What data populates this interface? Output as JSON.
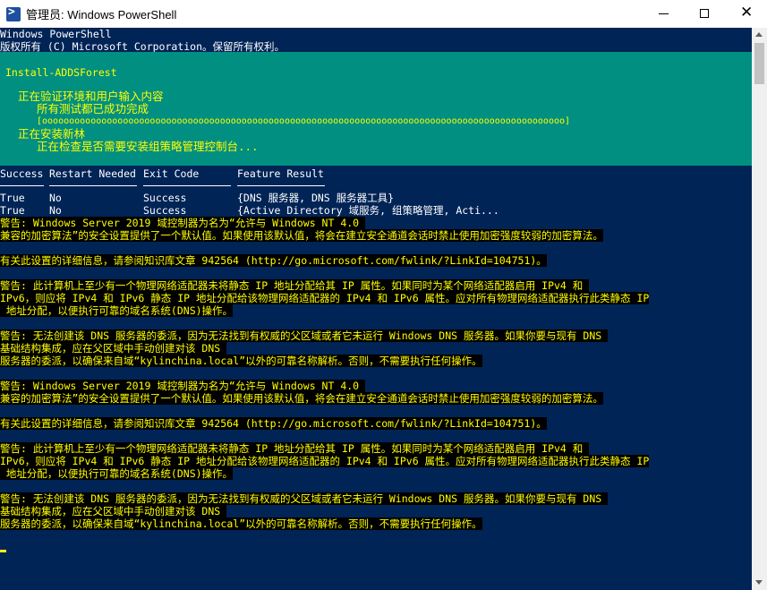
{
  "window": {
    "title": "管理员: Windows PowerShell",
    "icon": "powershell-icon",
    "controls": {
      "minimize": "minimize-icon",
      "maximize": "maximize-icon",
      "close": "close-icon"
    }
  },
  "console": {
    "banner": [
      "Windows PowerShell",
      "版权所有 (C) Microsoft Corporation。保留所有权利。"
    ],
    "progress": {
      "activity": "Install-ADDSForest",
      "status1": "正在验证环境和用户输入内容",
      "status1_detail": "所有测试都已成功完成",
      "bar": "[ooooooooooooooooooooooooooooooooooooooooooooooooooooooooooooooooooooooooooooooooooooooooooooooooo]",
      "status2": "正在安装新林",
      "status2_detail": "正在检查是否需要安装组策略管理控制台..."
    },
    "table": {
      "headers": [
        "Success",
        "Restart Needed",
        "Exit Code",
        "Feature Result"
      ],
      "rows": [
        [
          "True",
          "No",
          "Success",
          "{DNS 服务器, DNS 服务器工具}"
        ],
        [
          "True",
          "No",
          "Success",
          "{Active Directory 域服务, 组策略管理, Acti..."
        ]
      ]
    },
    "warnings": [
      "警告: Windows Server 2019 域控制器为名为“允许与 Windows NT 4.0 ",
      "兼容的加密算法”的安全设置提供了一个默认值。如果使用该默认值，将会在建立安全通道会话时禁止使用加密强度较弱的加密算法。",
      "有关此设置的详细信息，请参阅知识库文章 942564 (http://go.microsoft.com/fwlink/?LinkId=104751)。",
      "警告: 此计算机上至少有一个物理网络适配器未将静态 IP 地址分配给其 IP 属性。如果同时为某个网络适配器启用 IPv4 和 ",
      "IPv6，则应将 IPv4 和 IPv6 静态 IP 地址分配给该物理网络适配器的 IPv4 和 IPv6 属性。应对所有物理网络适配器执行此类静态 IP",
      " 地址分配，以便执行可靠的域名系统(DNS)操作。",
      "警告: 无法创建该 DNS 服务器的委派，因为无法找到有权威的父区域或者它未运行 Windows DNS 服务器。如果你要与现有 DNS ",
      "基础结构集成，应在父区域中手动创建对该 DNS ",
      "服务器的委派，以确保来自域“kylinchina.local”以外的可靠名称解析。否则，不需要执行任何操作。",
      "警告: Windows Server 2019 域控制器为名为“允许与 Windows NT 4.0 ",
      "兼容的加密算法”的安全设置提供了一个默认值。如果使用该默认值，将会在建立安全通道会话时禁止使用加密强度较弱的加密算法。",
      "有关此设置的详细信息，请参阅知识库文章 942564 (http://go.microsoft.com/fwlink/?LinkId=104751)。",
      "警告: 此计算机上至少有一个物理网络适配器未将静态 IP 地址分配给其 IP 属性。如果同时为某个网络适配器启用 IPv4 和 ",
      "IPv6，则应将 IPv4 和 IPv6 静态 IP 地址分配给该物理网络适配器的 IPv4 和 IPv6 属性。应对所有物理网络适配器执行此类静态 IP",
      " 地址分配，以便执行可靠的域名系统(DNS)操作。",
      "警告: 无法创建该 DNS 服务器的委派，因为无法找到有权威的父区域或者它未运行 Windows DNS 服务器。如果你要与现有 DNS ",
      "基础结构集成，应在父区域中手动创建对该 DNS ",
      "服务器的委派，以确保来自域“kylinchina.local”以外的可靠名称解析。否则，不需要执行任何操作。"
    ]
  },
  "colors": {
    "console_bg": "#012456",
    "progress_bg": "#008f81",
    "warning_fg": "#ffff00",
    "warning_bg": "#000000"
  }
}
